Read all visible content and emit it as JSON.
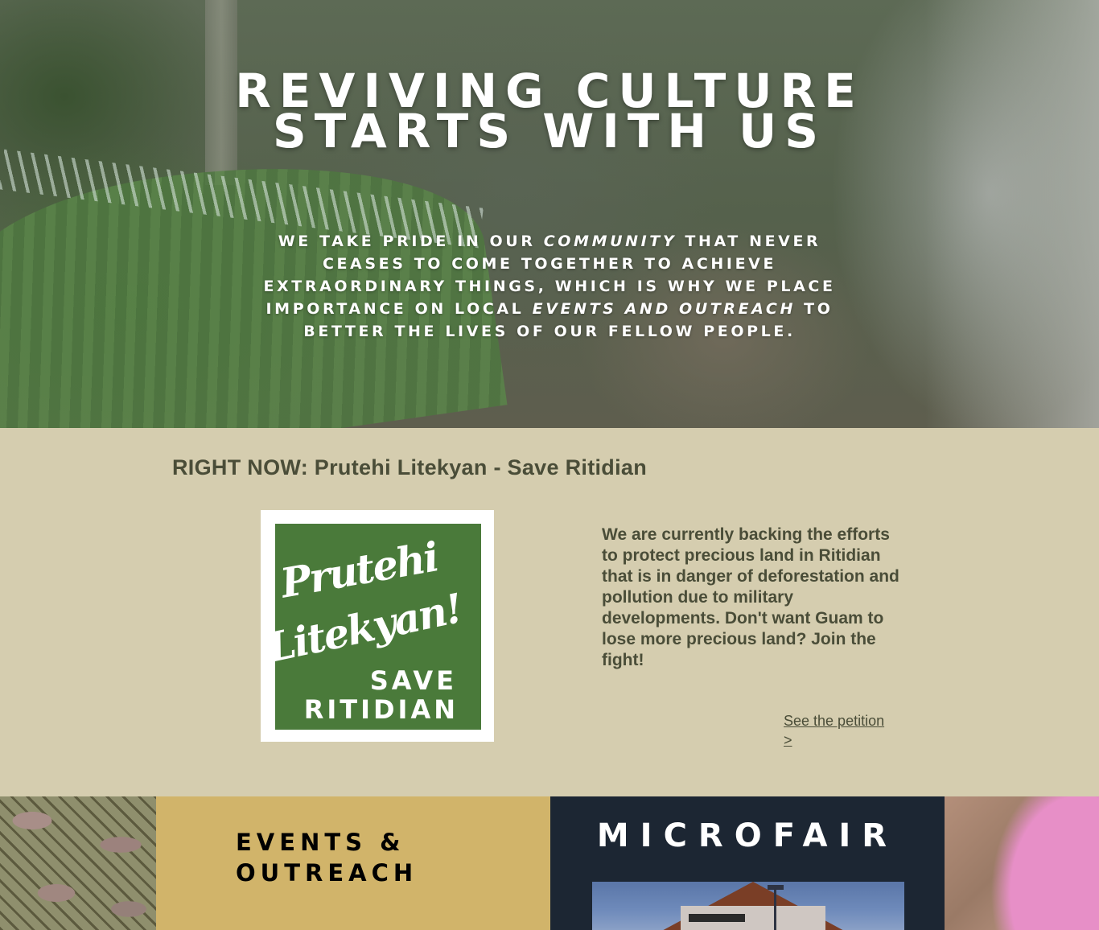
{
  "hero": {
    "title_line1": "REVIVING CULTURE",
    "title_line2": "STARTS WITH US",
    "text_part1": "WE TAKE PRIDE IN OUR ",
    "text_em1": "COMMUNITY",
    "text_part2": " THAT NEVER CEASES TO COME TOGETHER TO ACHIEVE EXTRAORDINARY THINGS, WHICH IS WHY WE PLACE IMPORTANCE ON LOCAL ",
    "text_em2": "EVENTS AND OUTREACH",
    "text_part3": " TO BETTER THE LIVES OF OUR FELLOW PEOPLE."
  },
  "right_now": {
    "title": "RIGHT NOW: Prutehi Litekyan - Save Ritidian",
    "logo": {
      "script_line1": "Prutehi",
      "script_line2": "Litekyan!",
      "save_line1": "SAVE",
      "save_line2": "RITIDIAN"
    },
    "description": "We are currently backing the efforts to protect precious land in Ritidian that is in danger of deforestation and pollution due to military developments. Don't want Guam to lose more precious land? Join the fight!",
    "petition_link": "See the petition >"
  },
  "strip": {
    "events_title": "EVENTS &\nOUTREACH",
    "microfair_title": "MICROFAIR"
  },
  "colors": {
    "beige_bg": "#d5cdaf",
    "olive_text": "#4a4d38",
    "gold": "#d1b46a",
    "navy": "#1c2633",
    "logo_green": "#4a7a3a"
  }
}
